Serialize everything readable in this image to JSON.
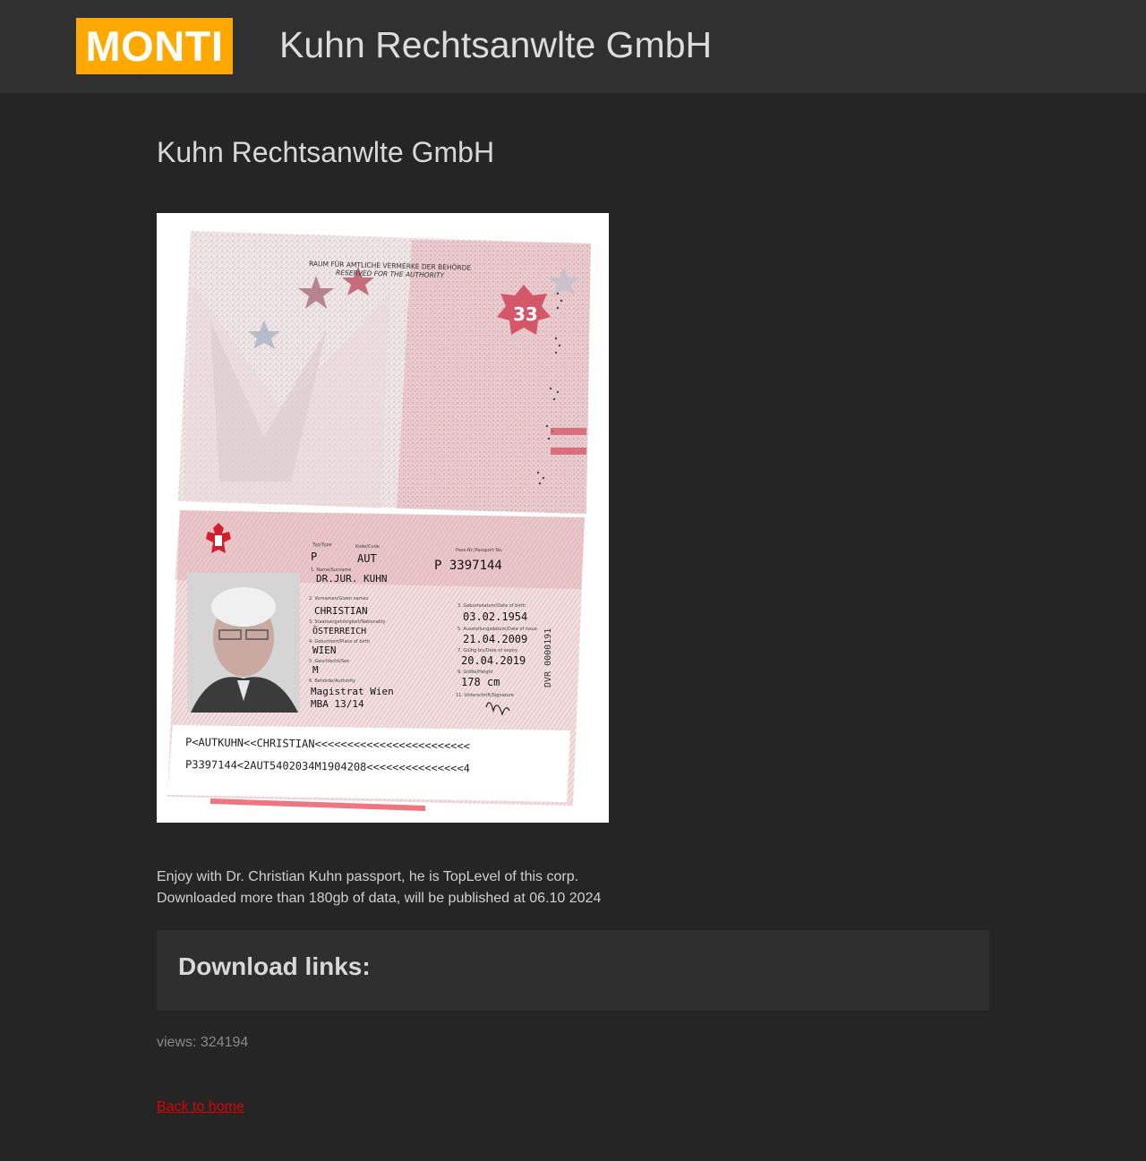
{
  "header": {
    "logo_text": "MONTI",
    "site_title": "Kuhn Rechtsanwlte GmbH"
  },
  "main": {
    "page_title": "Kuhn Rechtsanwlte GmbH",
    "description_lines": [
      "Enjoy with Dr. Christian Kuhn passport, he is TopLevel of this corp.",
      "Downloaded more than 180gb of data, will be published at 06.10 2024"
    ],
    "downloads_heading": "Download links:",
    "views_text": "views: 324194",
    "back_link": "Back to home"
  },
  "passport": {
    "authority_line1": "RAUM FÜR AMTLICHE VERMERKE DER BEHÖRDE",
    "authority_line2": "RESERVED FOR THE AUTHORITY",
    "type": "P",
    "code": "AUT",
    "passport_no": "P 3397144",
    "surname": "DR.JUR. KUHN",
    "given_names": "CHRISTIAN",
    "nationality": "ÖSTERREICH",
    "place_of_birth": "WIEN",
    "sex": "M",
    "authority": "Magistrat Wien",
    "authority_code": "MBA 13/14",
    "date_of_birth": "03.02.1954",
    "date_of_issue": "21.04.2009",
    "date_of_expiry": "20.04.2019",
    "height": "178 cm",
    "side_number": "DVR 0000191",
    "mrz_line1": "P<AUTKUHN<<CHRISTIAN<<<<<<<<<<<<<<<<<<<<<<<<",
    "mrz_line2": "P3397144<2AUT5402034M1904208<<<<<<<<<<<<<<<4"
  },
  "colors": {
    "logo_bg": "#ffa800",
    "link": "#e00000",
    "background": "#252525",
    "header_bg": "#303030"
  }
}
